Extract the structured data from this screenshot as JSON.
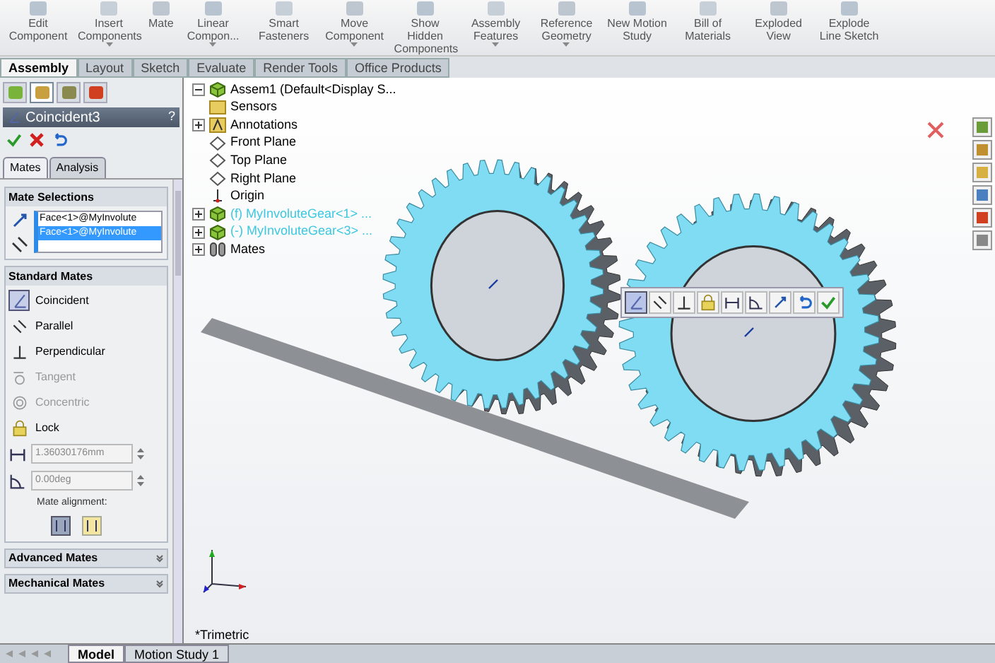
{
  "ribbon": [
    {
      "label": "Edit Component",
      "dropdown": false
    },
    {
      "label": "Insert Components",
      "dropdown": true
    },
    {
      "label": "Mate",
      "dropdown": false
    },
    {
      "label": "Linear Compon...",
      "dropdown": true
    },
    {
      "label": "Smart Fasteners",
      "dropdown": false
    },
    {
      "label": "Move Component",
      "dropdown": true
    },
    {
      "label": "Show Hidden Components",
      "dropdown": false
    },
    {
      "label": "Assembly Features",
      "dropdown": true
    },
    {
      "label": "Reference Geometry",
      "dropdown": true
    },
    {
      "label": "New Motion Study",
      "dropdown": false
    },
    {
      "label": "Bill of Materials",
      "dropdown": false
    },
    {
      "label": "Exploded View",
      "dropdown": false
    },
    {
      "label": "Explode Line Sketch",
      "dropdown": false
    }
  ],
  "tabs": [
    {
      "label": "Assembly",
      "selected": true
    },
    {
      "label": "Layout",
      "selected": false
    },
    {
      "label": "Sketch",
      "selected": false
    },
    {
      "label": "Evaluate",
      "selected": false
    },
    {
      "label": "Render Tools",
      "selected": false
    },
    {
      "label": "Office Products",
      "selected": false
    }
  ],
  "manager_tabs": [
    {
      "kind": "tree",
      "selected": false
    },
    {
      "kind": "property",
      "selected": true
    },
    {
      "kind": "config",
      "selected": false
    },
    {
      "kind": "display",
      "selected": false
    }
  ],
  "property_manager": {
    "title": "Coincident3",
    "help": "?",
    "subtabs": [
      {
        "label": "Mates",
        "selected": true
      },
      {
        "label": "Analysis",
        "selected": false
      }
    ],
    "mate_selections": {
      "title": "Mate Selections",
      "entries": [
        {
          "label": "Face<1>@MyInvolute",
          "selected": false
        },
        {
          "label": "Face<1>@MyInvolute",
          "selected": true
        }
      ]
    },
    "standard_mates": {
      "title": "Standard Mates",
      "items": [
        {
          "kind": "coincident",
          "label": "Coincident",
          "selected": true,
          "disabled": false
        },
        {
          "kind": "parallel",
          "label": "Parallel",
          "selected": false,
          "disabled": false
        },
        {
          "kind": "perpendicular",
          "label": "Perpendicular",
          "selected": false,
          "disabled": false
        },
        {
          "kind": "tangent",
          "label": "Tangent",
          "selected": false,
          "disabled": true
        },
        {
          "kind": "concentric",
          "label": "Concentric",
          "selected": false,
          "disabled": true
        },
        {
          "kind": "lock",
          "label": "Lock",
          "selected": false,
          "disabled": false
        },
        {
          "kind": "distance",
          "value": "1.36030176mm"
        },
        {
          "kind": "angle",
          "value": "0.00deg"
        }
      ],
      "alignment_label": "Mate alignment:",
      "alignment": [
        {
          "selected": true
        },
        {
          "selected": false
        }
      ]
    },
    "collapsed_sections": [
      "Advanced Mates",
      "Mechanical Mates"
    ]
  },
  "tree": {
    "label": "Assem1  (Default<Display S...",
    "expanded": true,
    "children": [
      {
        "label": "Sensors",
        "kind": "folder",
        "expandable": false,
        "highlight": false
      },
      {
        "label": "Annotations",
        "kind": "annotation",
        "expandable": true,
        "highlight": false
      },
      {
        "label": "Front Plane",
        "kind": "plane",
        "expandable": false,
        "highlight": false
      },
      {
        "label": "Top Plane",
        "kind": "plane",
        "expandable": false,
        "highlight": false
      },
      {
        "label": "Right Plane",
        "kind": "plane",
        "expandable": false,
        "highlight": false
      },
      {
        "label": "Origin",
        "kind": "origin",
        "expandable": false,
        "highlight": false
      },
      {
        "label": "(f) MyInvoluteGear<1> ...",
        "kind": "part",
        "expandable": true,
        "highlight": true
      },
      {
        "label": "(-) MyInvoluteGear<3> ...",
        "kind": "part",
        "expandable": true,
        "highlight": true
      },
      {
        "label": "Mates",
        "kind": "mates",
        "expandable": true,
        "highlight": false
      }
    ]
  },
  "popup_toolbar": [
    {
      "kind": "coincident",
      "selected": true
    },
    {
      "kind": "parallel",
      "selected": false
    },
    {
      "kind": "perpendicular",
      "selected": false
    },
    {
      "kind": "lock",
      "selected": false
    },
    {
      "kind": "distance",
      "selected": false
    },
    {
      "kind": "angle",
      "selected": false
    },
    {
      "kind": "flip",
      "selected": false
    },
    {
      "kind": "undo",
      "selected": false
    },
    {
      "kind": "ok",
      "selected": false
    }
  ],
  "view_label": "*Trimetric",
  "bottom_tabs": [
    {
      "label": "Model",
      "selected": true
    },
    {
      "label": "Motion Study 1",
      "selected": false
    }
  ]
}
